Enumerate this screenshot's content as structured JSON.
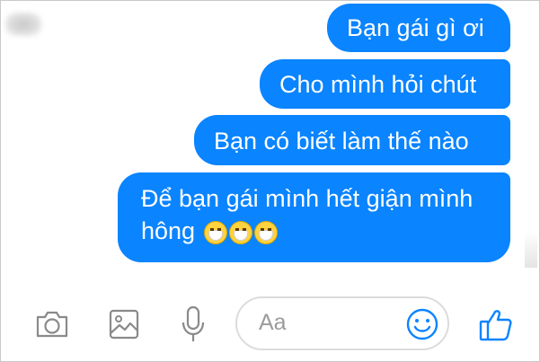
{
  "conversation": {
    "messages": [
      {
        "lines": [
          "Bạn gái gì ơi"
        ]
      },
      {
        "lines": [
          "Cho mình hỏi chút"
        ]
      },
      {
        "lines": [
          "Bạn có biết làm thế nào"
        ]
      },
      {
        "lines": [
          "Để bạn gái mình hết giận mình",
          "hông"
        ],
        "emoji_count": 3,
        "emoji": "face-with-mask-emoji"
      }
    ],
    "bubble_color": "#0a84ff",
    "text_color": "#ffffff"
  },
  "composer": {
    "placeholder": "Aa",
    "tools": [
      "camera-icon",
      "image-icon",
      "microphone-icon",
      "emoji-icon",
      "thumbs-up-icon"
    ],
    "icon_color": "#0a84ff"
  }
}
